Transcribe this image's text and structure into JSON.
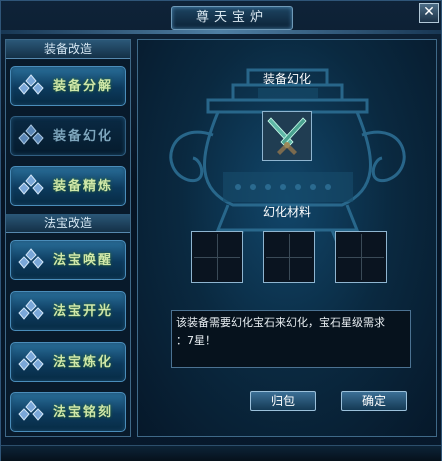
{
  "window": {
    "title": "尊天宝炉",
    "close_glyph": "✕"
  },
  "left_panel": {
    "sections": [
      {
        "header": "装备改造",
        "items": [
          {
            "label": "装备分解",
            "selected": false
          },
          {
            "label": "装备幻化",
            "selected": true
          },
          {
            "label": "装备精炼",
            "selected": false
          }
        ]
      },
      {
        "header": "法宝改造",
        "items": [
          {
            "label": "法宝唤醒",
            "selected": false
          },
          {
            "label": "法宝开光",
            "selected": false
          },
          {
            "label": "法宝炼化",
            "selected": false
          },
          {
            "label": "法宝铭刻",
            "selected": false
          }
        ]
      }
    ]
  },
  "main": {
    "equip_title": "装备幻化",
    "equip_slot_icon": "twin-blades-icon",
    "materials_title": "幻化材料",
    "message_line1": "该装备需要幻化宝石来幻化，宝石星级需求",
    "message_line2": "：7星！",
    "buttons": {
      "return_label": "归包",
      "confirm_label": "确定"
    }
  },
  "colors": {
    "menu_text": "#cfe7a9",
    "accent": "#4a8dba"
  }
}
